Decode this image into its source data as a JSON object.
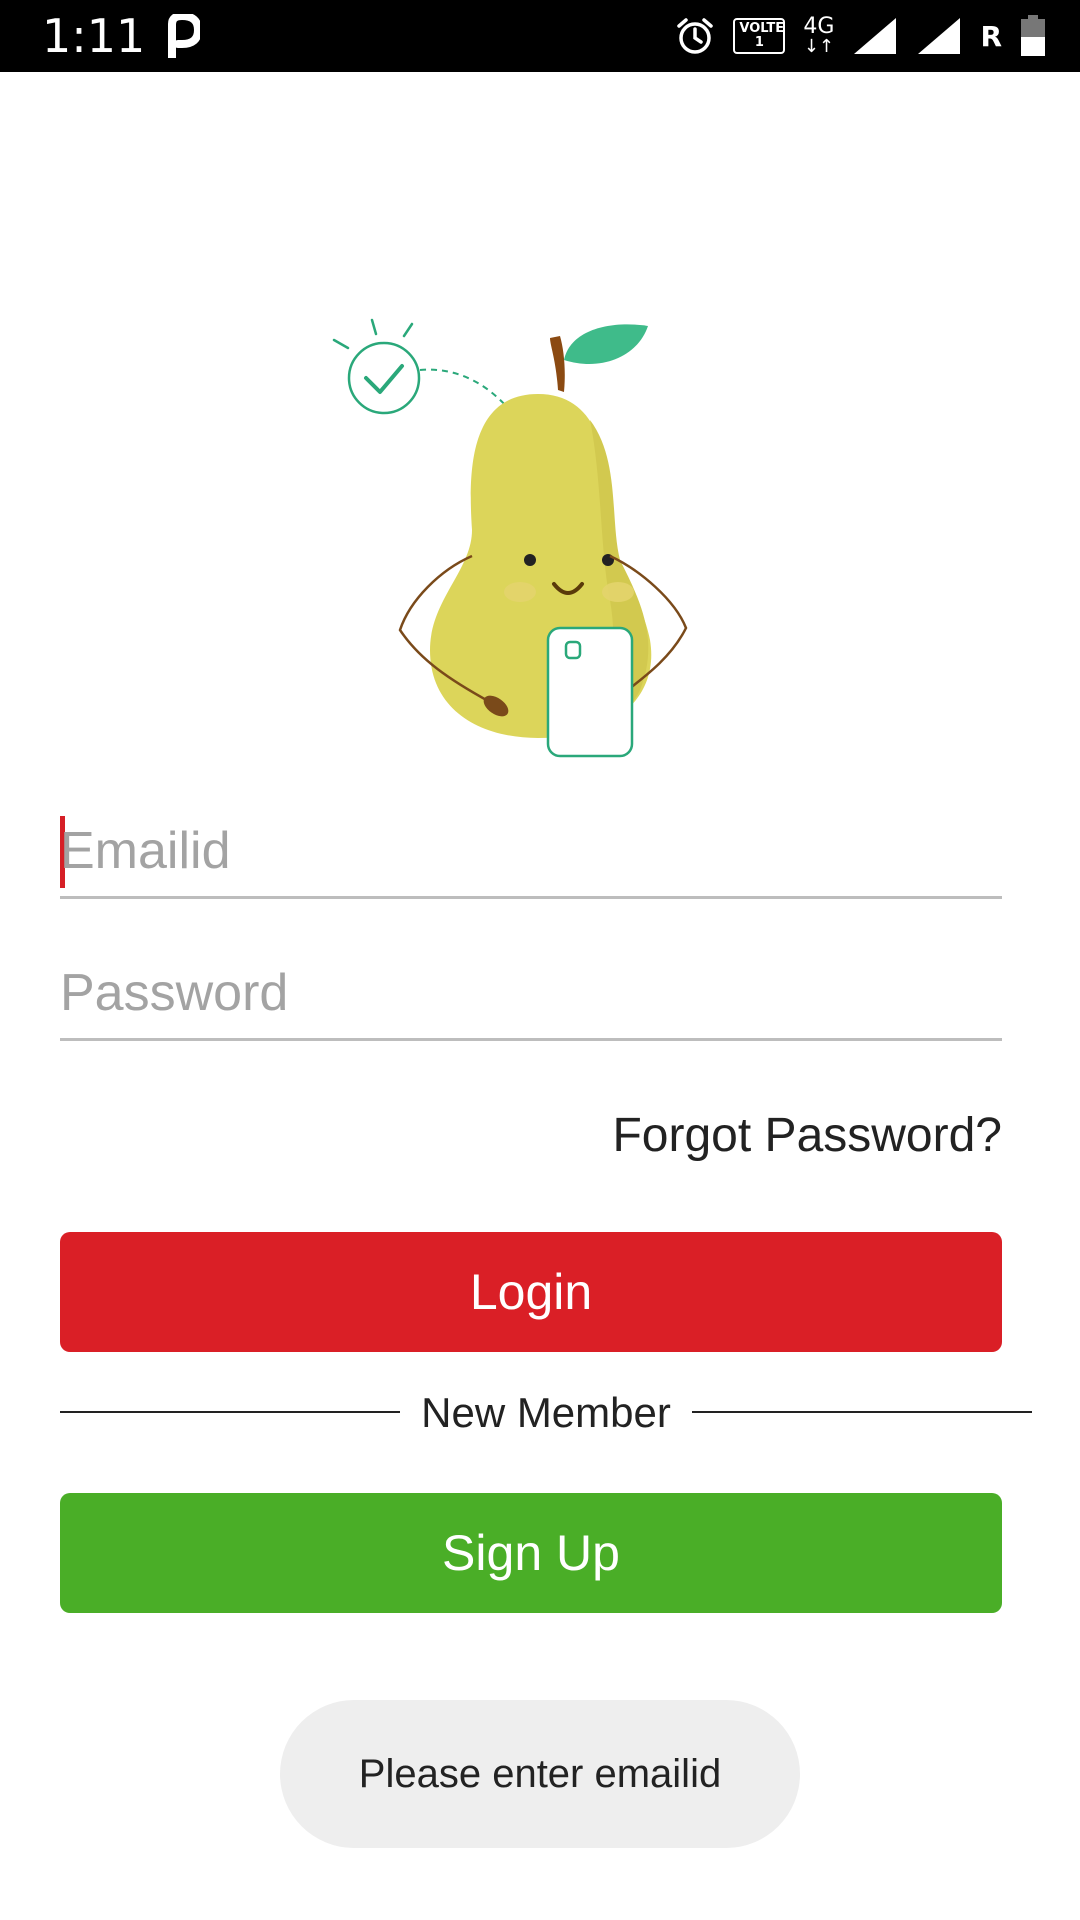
{
  "status_bar": {
    "time": "1:11",
    "app_icon": "p-app-icon",
    "alarm_icon": "alarm-icon",
    "volte_label": "VOLTE",
    "volte_sub": "1",
    "network_label": "4G",
    "roaming_label": "R",
    "signal_icons": [
      "signal-icon",
      "signal-icon"
    ],
    "battery_icon": "battery-icon"
  },
  "illustration": {
    "icon": "pear-holding-phone-illustration",
    "colors": {
      "pear": "#dcd55a",
      "leaf": "#3fbb8a",
      "stem": "#8b4a12",
      "accent": "#2aa87a"
    }
  },
  "login_form": {
    "email_placeholder": "Emailid",
    "email_value": "",
    "password_placeholder": "Password",
    "password_value": "",
    "forgot_password_label": "Forgot Password?",
    "login_label": "Login",
    "new_member_label": "New Member",
    "signup_label": "Sign Up"
  },
  "toast": {
    "message": "Please enter emailid"
  },
  "colors": {
    "login_button": "#da1f26",
    "signup_button": "#4aae27",
    "caret": "#d61f26",
    "toast_bg": "#eeeeee"
  }
}
